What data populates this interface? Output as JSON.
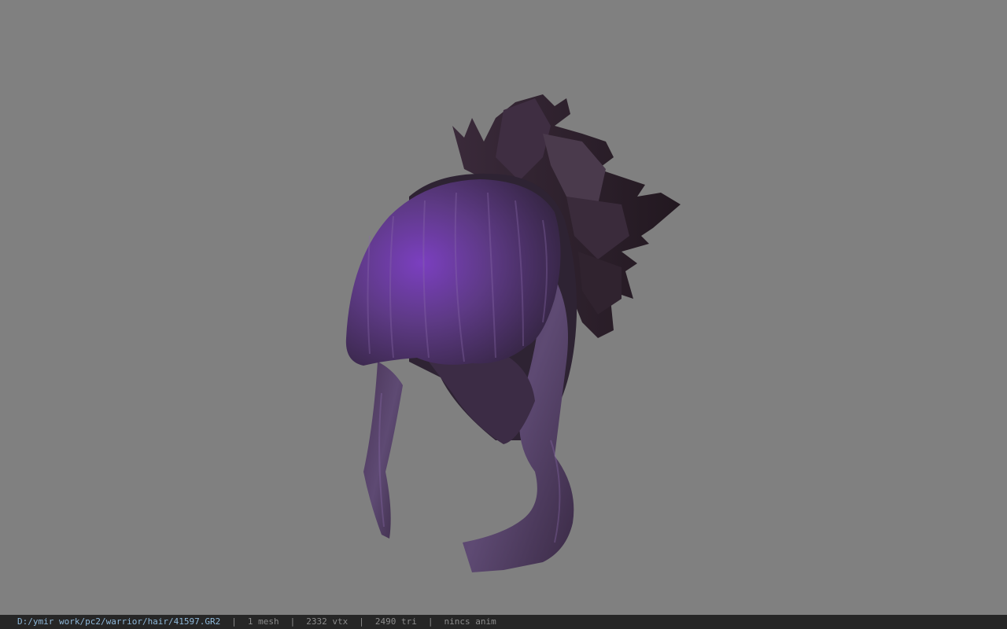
{
  "viewport": {
    "background": "#808080",
    "model": "purple-hair-mesh"
  },
  "status": {
    "file_path": "D:/ymir work/pc2/warrior/hair/41597.GR2",
    "mesh_count": "1 mesh",
    "vertex_count": "2332 vtx",
    "triangle_count": "2490 tri",
    "anim_status": "nincs anim",
    "separator": "|"
  },
  "colors": {
    "statusbar_bg": "#262626",
    "path_text": "#8fb8d9",
    "stat_text": "#8c8c8c",
    "hair_light": "#7a4fb0",
    "hair_mid": "#4e3560",
    "hair_dark": "#2a1d2e"
  }
}
